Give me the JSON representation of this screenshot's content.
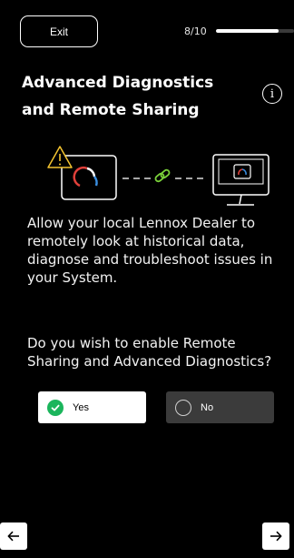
{
  "header": {
    "exit_label": "Exit",
    "progress_text": "8/10",
    "progress_fraction": 0.8
  },
  "title": {
    "line1": "Advanced Diagnostics",
    "line2": "and Remote Sharing"
  },
  "info_icon": "info-icon",
  "illustration": {
    "warning_icon": "warning-icon",
    "thermostat_icon": "thermostat-icon",
    "link_icon": "link-icon",
    "monitor_icon": "monitor-icon",
    "link_color": "#7ad13a",
    "warning_color": "#f4c430",
    "gauge_red": "#e0403a",
    "gauge_blue": "#3a8ee0"
  },
  "body": {
    "paragraph1": "Allow your local Lennox Dealer to remotely look at historical data, diagnose and troubleshoot issues in your System.",
    "paragraph2": "Do you wish to enable Remote Sharing and Advanced Diagnostics?"
  },
  "options": {
    "yes_label": "Yes",
    "no_label": "No",
    "selected": "Yes",
    "accent_color": "#1bb55c"
  },
  "nav": {
    "back_icon": "arrow-left-icon",
    "next_icon": "arrow-right-icon"
  }
}
